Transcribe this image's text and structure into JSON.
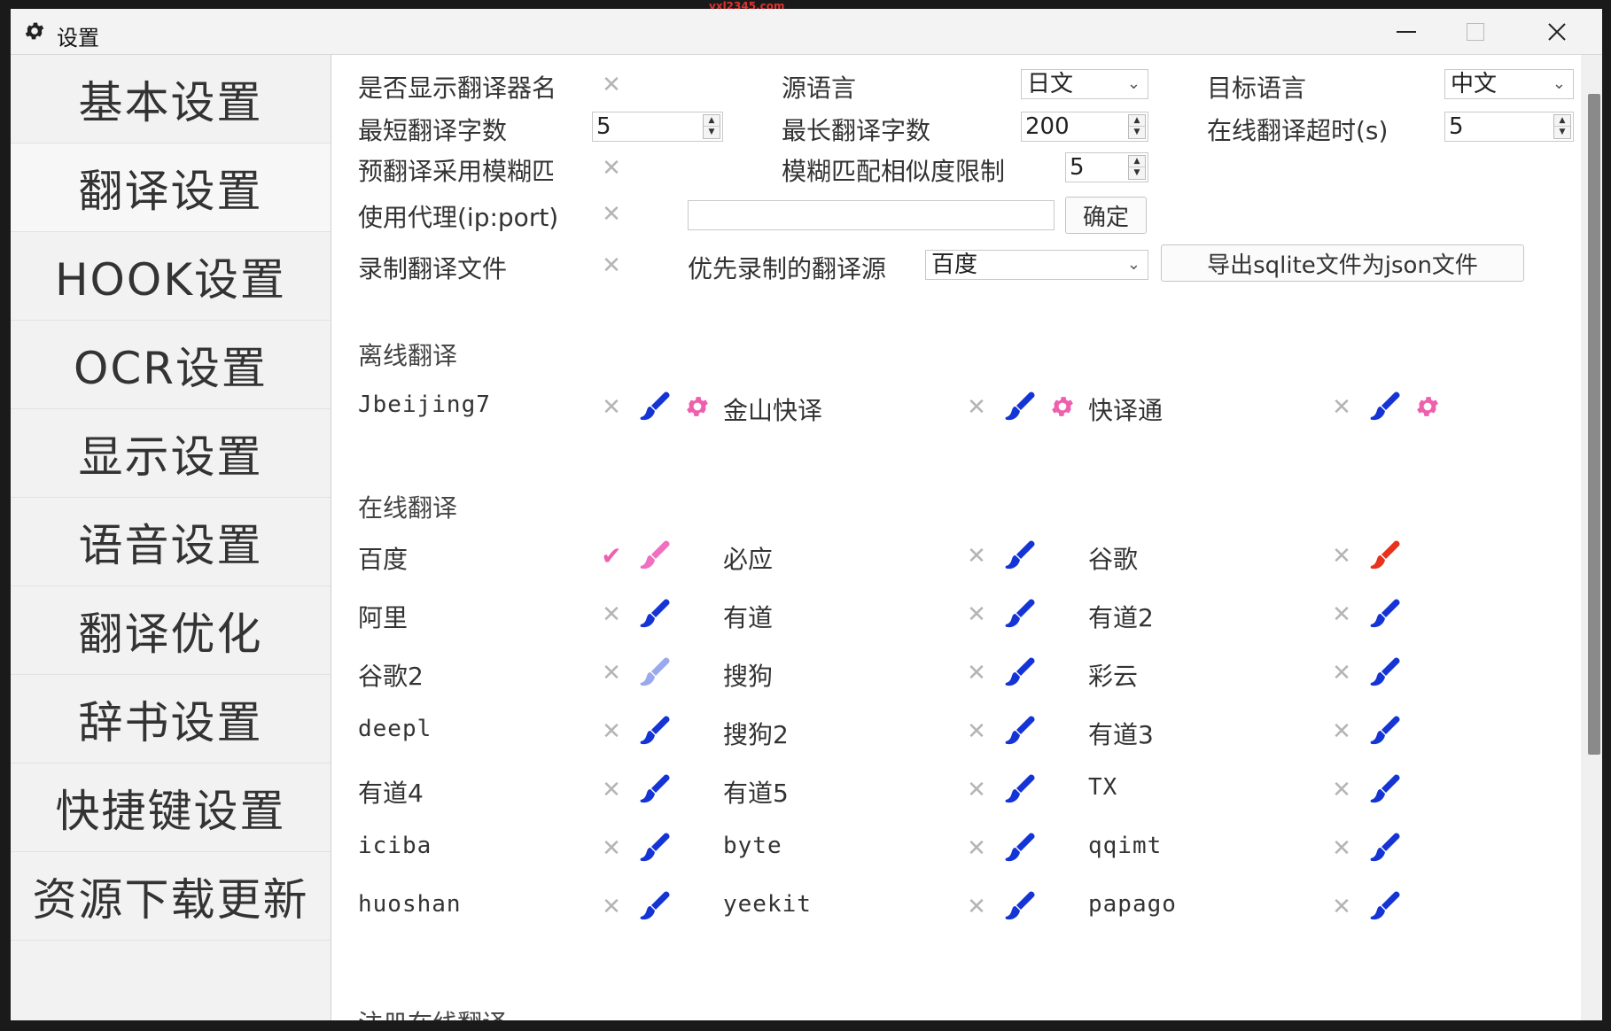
{
  "watermark": "yxl2345.com",
  "window": {
    "title": "设置"
  },
  "sidebar": {
    "items": [
      {
        "label": "基本设置"
      },
      {
        "label": "翻译设置"
      },
      {
        "label": "HOOK设置"
      },
      {
        "label": "OCR设置"
      },
      {
        "label": "显示设置"
      },
      {
        "label": "语音设置"
      },
      {
        "label": "翻译优化"
      },
      {
        "label": "辞书设置"
      },
      {
        "label": "快捷键设置"
      },
      {
        "label": "资源下载更新"
      }
    ],
    "active_index": 1
  },
  "settings": {
    "show_translator_name": {
      "label": "是否显示翻译器名称"
    },
    "source_lang": {
      "label": "源语言",
      "value": "日文"
    },
    "target_lang": {
      "label": "目标语言",
      "value": "中文"
    },
    "min_chars": {
      "label": "最短翻译字数",
      "value": "5"
    },
    "max_chars": {
      "label": "最长翻译字数",
      "value": "200"
    },
    "timeout": {
      "label": "在线翻译超时(s)",
      "value": "5"
    },
    "fuzzy_match": {
      "label": "预翻译采用模糊匹配"
    },
    "fuzzy_limit": {
      "label": "模糊匹配相似度限制",
      "value": "5"
    },
    "proxy": {
      "label": "使用代理(ip:port)",
      "value": "",
      "confirm": "确定"
    },
    "record": {
      "label": "录制翻译文件"
    },
    "record_source": {
      "label": "优先录制的翻译源",
      "value": "百度"
    },
    "export_button": "导出sqlite文件为json文件"
  },
  "offline": {
    "title": "离线翻译",
    "items": [
      {
        "name": "Jbeijing7",
        "enabled": false,
        "color": "#1434d6"
      },
      {
        "name": "金山快译",
        "enabled": false,
        "color": "#1434d6"
      },
      {
        "name": "快译通",
        "enabled": false,
        "color": "#1434d6"
      }
    ]
  },
  "online": {
    "title": "在线翻译",
    "items": [
      {
        "name": "百度",
        "enabled": true,
        "color": "#f06fc0"
      },
      {
        "name": "必应",
        "enabled": false,
        "color": "#1434d6"
      },
      {
        "name": "谷歌",
        "enabled": false,
        "color": "#e8321e"
      },
      {
        "name": "阿里",
        "enabled": false,
        "color": "#1434d6"
      },
      {
        "name": "有道",
        "enabled": false,
        "color": "#1434d6"
      },
      {
        "name": "有道2",
        "enabled": false,
        "color": "#1434d6"
      },
      {
        "name": "谷歌2",
        "enabled": false,
        "color": "#9aa8ee"
      },
      {
        "name": "搜狗",
        "enabled": false,
        "color": "#1434d6"
      },
      {
        "name": "彩云",
        "enabled": false,
        "color": "#1434d6"
      },
      {
        "name": "deepl",
        "enabled": false,
        "color": "#1434d6"
      },
      {
        "name": "搜狗2",
        "enabled": false,
        "color": "#1434d6"
      },
      {
        "name": "有道3",
        "enabled": false,
        "color": "#1434d6"
      },
      {
        "name": "有道4",
        "enabled": false,
        "color": "#1434d6"
      },
      {
        "name": "有道5",
        "enabled": false,
        "color": "#1434d6"
      },
      {
        "name": "TX",
        "enabled": false,
        "color": "#1434d6"
      },
      {
        "name": "iciba",
        "enabled": false,
        "color": "#1434d6"
      },
      {
        "name": "byte",
        "enabled": false,
        "color": "#1434d6"
      },
      {
        "name": "qqimt",
        "enabled": false,
        "color": "#1434d6"
      },
      {
        "name": "huoshan",
        "enabled": false,
        "color": "#1434d6"
      },
      {
        "name": "yeekit",
        "enabled": false,
        "color": "#1434d6"
      },
      {
        "name": "papago",
        "enabled": false,
        "color": "#1434d6"
      }
    ]
  },
  "registered": {
    "title": "注册在线翻译"
  },
  "colors": {
    "gear_pink": "#ee5fae",
    "cross_gray": "#b5b5b5"
  }
}
